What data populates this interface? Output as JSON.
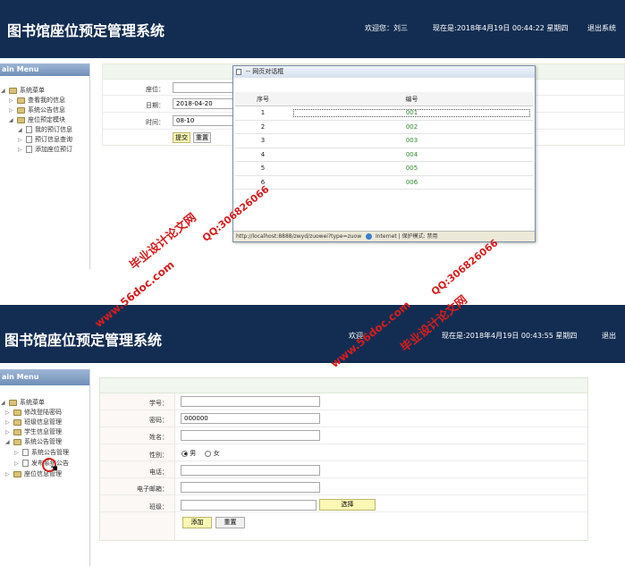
{
  "app_title": "图书馆座位预定管理系统",
  "top": {
    "welcome": "欢迎您：刘三",
    "time": "现在是:2018年4月19日 00:44:22 星期四",
    "logout": "退出系统",
    "sidebar_title": "ain Menu",
    "tree": [
      "系统菜单",
      "查看我的信息",
      "系统公告信息",
      "座位预定模块",
      "我的预订信息",
      "预订信息查询",
      "添加座位预订"
    ],
    "form": {
      "seat_label": "座位：",
      "date_label": "日期：",
      "date_value": "2018-04-20",
      "time_label": "时间：",
      "time_value": "08-10",
      "submit": "提交",
      "reset": "重置"
    },
    "dialog": {
      "title": "-- 网页对话框",
      "col_no": "序号",
      "col_code": "编号",
      "rows": [
        {
          "no": "1",
          "code": "001"
        },
        {
          "no": "2",
          "code": "002"
        },
        {
          "no": "3",
          "code": "003"
        },
        {
          "no": "4",
          "code": "004"
        },
        {
          "no": "5",
          "code": "005"
        },
        {
          "no": "6",
          "code": "006"
        }
      ],
      "status": "http://localhost:8888/zwyd/zuowei?type=zuow",
      "zone": "Internet | 保护模式: 禁用"
    }
  },
  "bottom": {
    "welcome": "欢迎",
    "time": "现在是:2018年4月19日 00:43:55 星期四",
    "logout": "退出",
    "sidebar_title": "ain Menu",
    "tree": [
      "系统菜单",
      "修改登陆密码",
      "班级信息管理",
      "学生信息管理",
      "系统公告管理",
      "系统公告管理",
      "发布系统公告",
      "座位信息管理"
    ],
    "form": {
      "student_no": "学号：",
      "password": "密码：",
      "password_value": "000000",
      "name": "姓名：",
      "gender": "性别：",
      "male": "男",
      "female": "女",
      "phone": "电话：",
      "email": "电子邮箱：",
      "class": "班级：",
      "choose": "选择",
      "add": "添加",
      "reset": "重置"
    }
  },
  "watermarks": [
    "毕业设计论文网",
    "www.56doc.com",
    "QQ:306826066",
    "www.56doc.com",
    "QQ:306826066",
    "毕业设计论文网"
  ]
}
